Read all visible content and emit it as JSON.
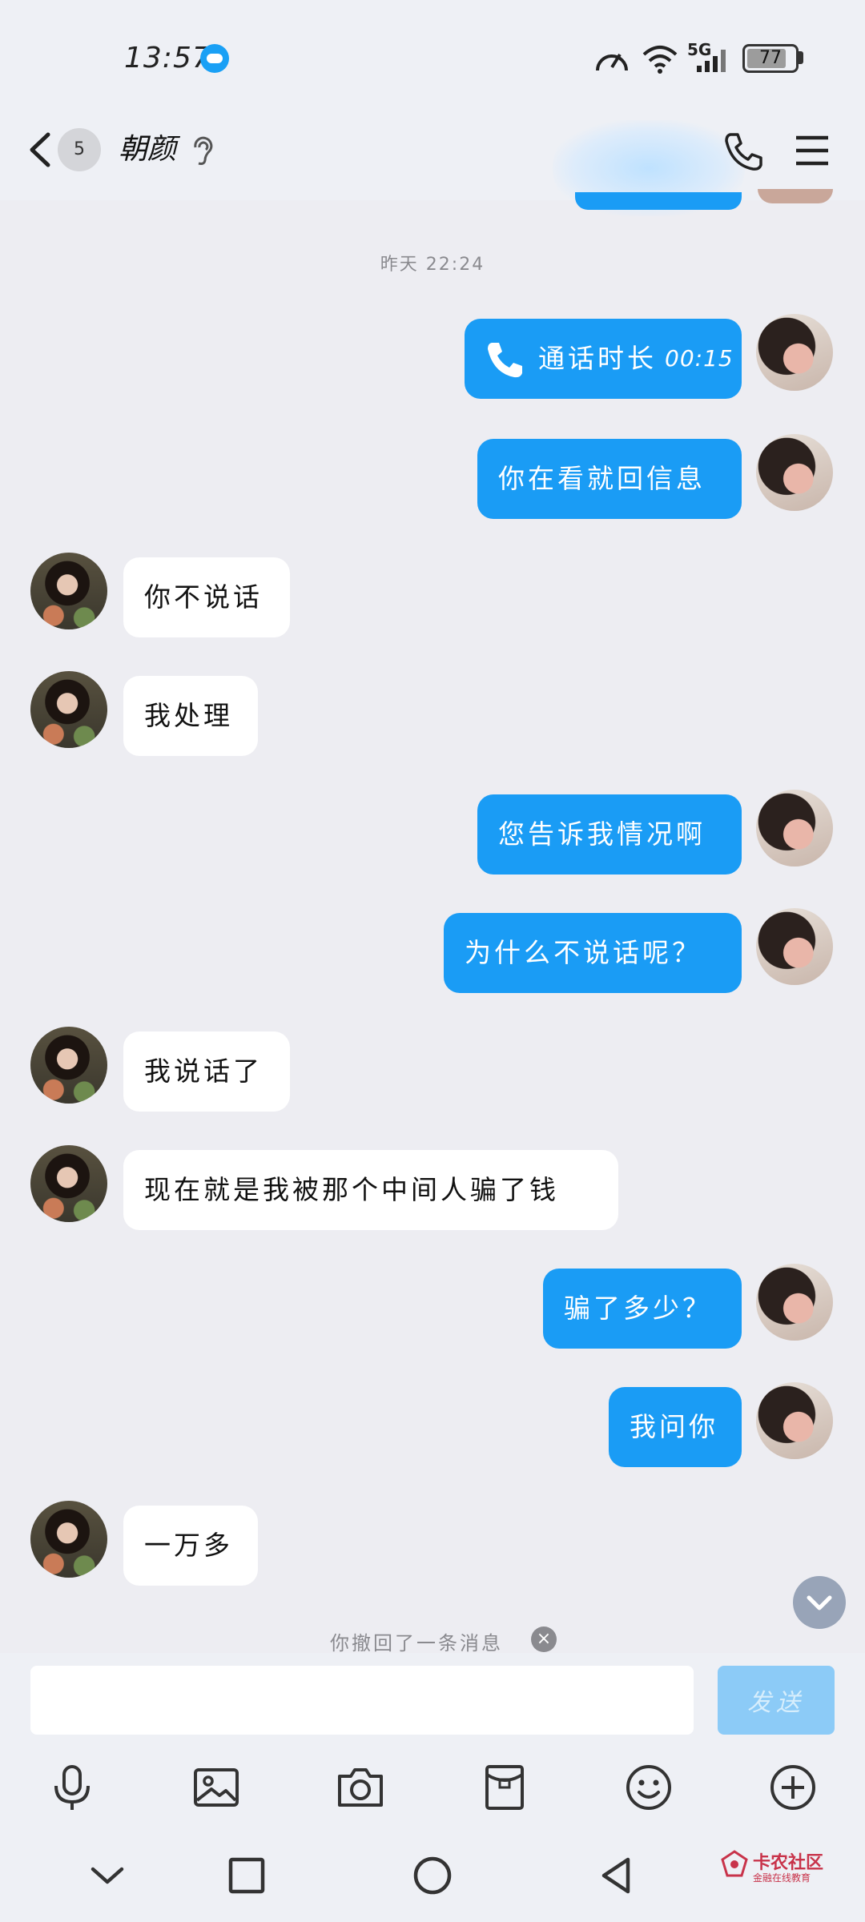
{
  "status_bar": {
    "time": "13:57",
    "network": "5G",
    "battery": "77",
    "icons": [
      "cloud-icon",
      "speed-icon",
      "wifi-icon",
      "signal-icon",
      "battery-icon"
    ]
  },
  "header": {
    "unread_count": "5",
    "contact_name": "朝颜",
    "icons": [
      "back-icon",
      "ear-icon",
      "phone-icon",
      "menu-icon"
    ]
  },
  "chat": {
    "date_label": "昨天 22:24",
    "call_label": "通话时长",
    "call_duration": "00:15",
    "messages": [
      {
        "side": "out",
        "text": "你在看就回信息"
      },
      {
        "side": "in",
        "text": "你不说话"
      },
      {
        "side": "in",
        "text": "我处理"
      },
      {
        "side": "out",
        "text": "您告诉我情况啊"
      },
      {
        "side": "out",
        "text": "为什么不说话呢？"
      },
      {
        "side": "in",
        "text": "我说话了"
      },
      {
        "side": "in",
        "text": "现在就是我被那个中间人骗了钱"
      },
      {
        "side": "out",
        "text": "骗了多少？"
      },
      {
        "side": "out",
        "text": "我问你"
      },
      {
        "side": "in",
        "text": "一万多"
      }
    ],
    "recall_notice": "你撤回了一条消息"
  },
  "input": {
    "value": "",
    "send_label": "发送"
  },
  "toolbar": {
    "icons": [
      "microphone-icon",
      "image-icon",
      "camera-icon",
      "red-packet-icon",
      "emoji-icon",
      "plus-icon"
    ]
  },
  "watermark": {
    "title": "卡农社区",
    "subtitle": "金融在线教育"
  }
}
